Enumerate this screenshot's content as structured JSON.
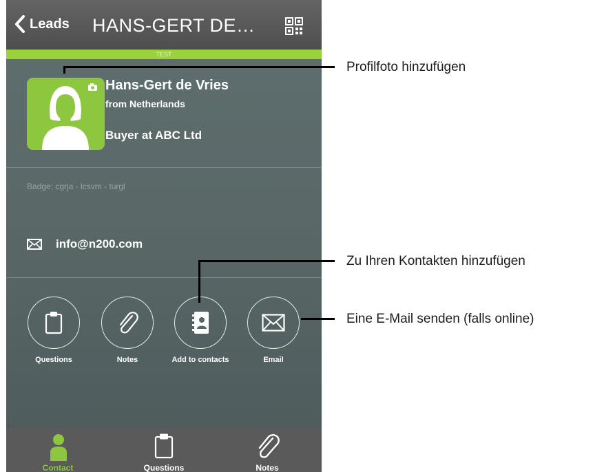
{
  "navbar": {
    "back_label": "Leads",
    "title": "HANS-GERT DE…",
    "qr_icon": "qr-code-icon"
  },
  "env_label": "TEST",
  "contact": {
    "name": "Hans-Gert de Vries",
    "origin": "from Netherlands",
    "job": "Buyer at ABC Ltd",
    "badge": "Badge: cgrja - lcsvm - turgl",
    "email": "info@n200.com"
  },
  "actions": [
    {
      "label": "Questions",
      "icon": "clipboard-icon"
    },
    {
      "label": "Notes",
      "icon": "paperclip-icon"
    },
    {
      "label": "Add to contacts",
      "icon": "address-book-icon"
    },
    {
      "label": "Email",
      "icon": "envelope-icon"
    }
  ],
  "tabs": [
    {
      "label": "Contact",
      "icon": "person-icon",
      "active": true
    },
    {
      "label": "Questions",
      "icon": "clipboard-icon",
      "active": false
    },
    {
      "label": "Notes",
      "icon": "paperclip-icon",
      "active": false
    }
  ],
  "callouts": {
    "photo": "Profilfoto hinzufügen",
    "contacts": "Zu Ihren Kontakten hinzufügen",
    "email": "Eine E-Mail senden (falls online)"
  },
  "colors": {
    "accent": "#8dc63f",
    "panel": "#5c6a6a",
    "navbar": "#555555"
  }
}
